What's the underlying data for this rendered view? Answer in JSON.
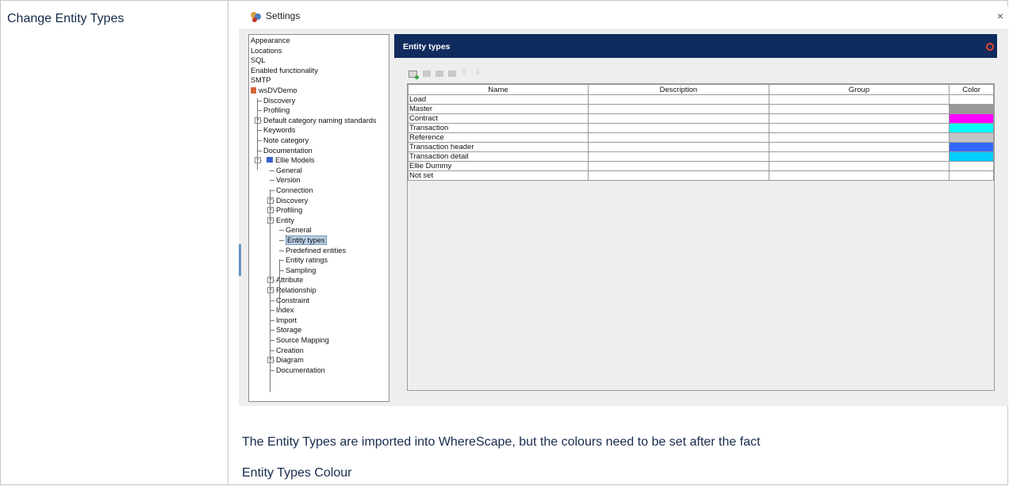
{
  "page": {
    "row_label": "Change Entity Types",
    "paragraph1": "The Entity Types are imported into WhereScape, but the colours need to be set after the fact",
    "paragraph2": "Entity Types  Colour"
  },
  "window": {
    "title": "Settings",
    "close": "×"
  },
  "tree": {
    "items": [
      {
        "label": "Appearance"
      },
      {
        "label": "Locations"
      },
      {
        "label": "SQL"
      },
      {
        "label": "Enabled functionality"
      },
      {
        "label": "SMTP"
      },
      {
        "label": "wsDVDemo"
      },
      {
        "label": "Discovery"
      },
      {
        "label": "Profiling"
      },
      {
        "label": "Default category naming standards"
      },
      {
        "label": "Keywords"
      },
      {
        "label": "Note category"
      },
      {
        "label": "Documentation"
      },
      {
        "label": "Ellie Models"
      },
      {
        "label": "General"
      },
      {
        "label": "Version"
      },
      {
        "label": "Connection"
      },
      {
        "label": "Discovery"
      },
      {
        "label": "Profiling"
      },
      {
        "label": "Entity"
      },
      {
        "label": "General"
      },
      {
        "label": "Entity types"
      },
      {
        "label": "Predefined entities"
      },
      {
        "label": "Entity ratings"
      },
      {
        "label": "Sampling"
      },
      {
        "label": "Attribute"
      },
      {
        "label": "Relationship"
      },
      {
        "label": "Constraint"
      },
      {
        "label": "Index"
      },
      {
        "label": "Import"
      },
      {
        "label": "Storage"
      },
      {
        "label": "Source Mapping"
      },
      {
        "label": "Creation"
      },
      {
        "label": "Diagram"
      },
      {
        "label": "Documentation"
      }
    ],
    "selected": "Entity types"
  },
  "panel": {
    "title": "Entity types",
    "toolbar": [
      "add-icon",
      "edit-icon",
      "copy-icon",
      "delete-icon",
      "arrow-up-icon",
      "arrow-down-icon"
    ]
  },
  "grid": {
    "headers": [
      "Name",
      "Description",
      "Group",
      "Color"
    ],
    "rows": [
      {
        "name": "Load",
        "description": "",
        "group": "",
        "color": "#ffffff"
      },
      {
        "name": "Master",
        "description": "",
        "group": "",
        "color": "#9a9a9a"
      },
      {
        "name": "Contract",
        "description": "",
        "group": "",
        "color": "#ff00ff"
      },
      {
        "name": "Transaction",
        "description": "",
        "group": "",
        "color": "#00ffff"
      },
      {
        "name": "Reference",
        "description": "",
        "group": "",
        "color": "#c4c4c4"
      },
      {
        "name": "Transaction header",
        "description": "",
        "group": "",
        "color": "#3366ff"
      },
      {
        "name": "Transaction detail",
        "description": "",
        "group": "",
        "color": "#00ccff"
      },
      {
        "name": "Ellie Dummy",
        "description": "",
        "group": "",
        "color": "#ffffff"
      },
      {
        "name": "Not set",
        "description": "",
        "group": "",
        "color": "#ffffff"
      }
    ]
  },
  "colors": {
    "panel_header": "#102b5e",
    "selection": "#b8cfe5"
  }
}
